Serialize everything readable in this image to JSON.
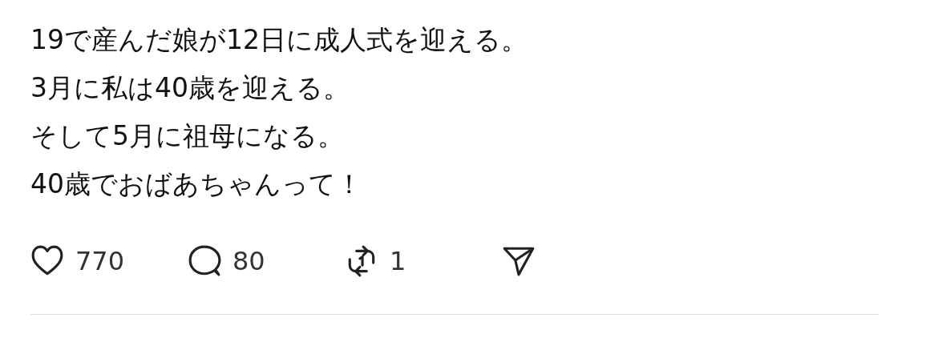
{
  "post": {
    "lines": [
      "19で産んだ娘が12日に成人式を迎える。",
      "3月に私は40歳を迎える。",
      "そして5月に祖母になる。",
      "40歳でおばあちゃんって！"
    ]
  },
  "actions": [
    {
      "kind": "like",
      "count": "770"
    },
    {
      "kind": "comment",
      "count": "80"
    },
    {
      "kind": "repost",
      "count": "1"
    },
    {
      "kind": "share"
    }
  ]
}
